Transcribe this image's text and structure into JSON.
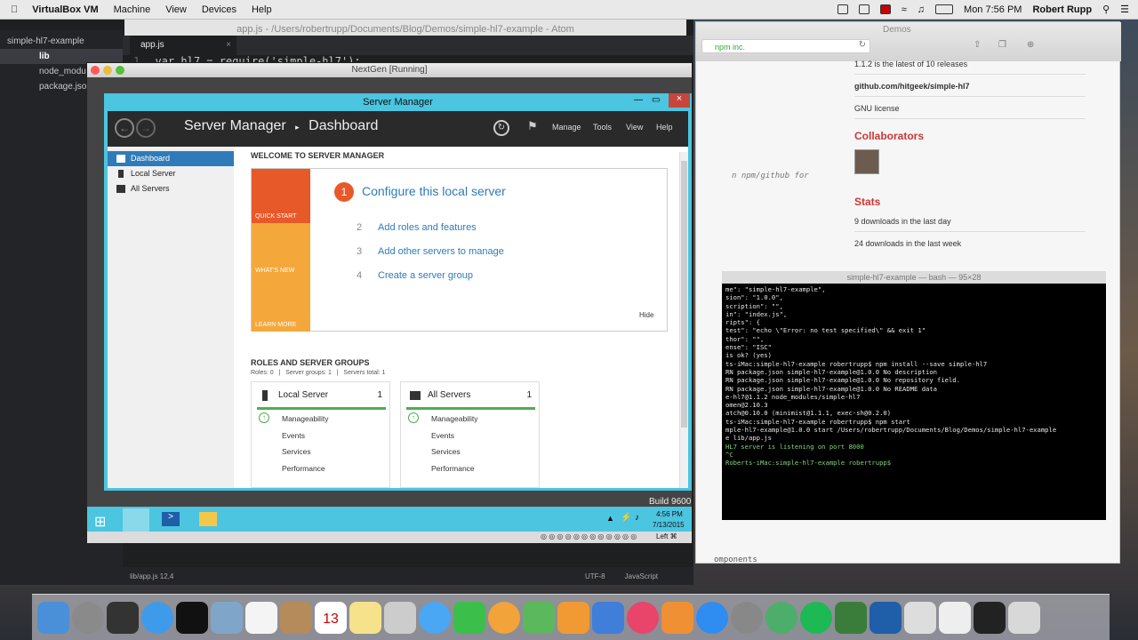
{
  "menubar": {
    "app_name": "VirtualBox VM",
    "items": [
      "Machine",
      "View",
      "Devices",
      "Help"
    ],
    "clock": "Mon 7:56 PM",
    "user": "Robert Rupp"
  },
  "atom": {
    "title": "app.js - /Users/robertrupp/Documents/Blog/Demos/simple-hl7-example - Atom",
    "tree": [
      "simple-hl7-example",
      "lib",
      "node_modules",
      "package.json"
    ],
    "tab": "app.js",
    "code_line_num": "1",
    "code_line": "var hl7 = require('simple-hl7');",
    "status_left": "lib/app.js  12,4",
    "status_enc": "UTF-8",
    "status_lang": "JavaScript"
  },
  "safari": {
    "title": "Demos",
    "address": "npm inc.",
    "releases": "1.1.2 is the latest of 10 releases",
    "repo": "github.com/hitgeek/simple-hl7",
    "license": "GNU license",
    "collaborators_heading": "Collaborators",
    "stats_heading": "Stats",
    "stat1": "9 downloads in the last day",
    "stat2": "24 downloads in the last week",
    "italic_hint": "n npm/github for",
    "components": "omponents"
  },
  "terminal": {
    "title": "simple-hl7-example — bash — 95×28",
    "lines": [
      "me\": \"simple-hl7-example\",",
      "sion\": \"1.0.0\",",
      "scription\": \"\",",
      "in\": \"index.js\",",
      "ripts\": {",
      "test\": \"echo \\\"Error: no test specified\\\" && exit 1\"",
      "",
      "thor\": \"\",",
      "ense\": \"ISC\"",
      "",
      "",
      "is ok? (yes)",
      "ts-iMac:simple-hl7-example robertrupp$ npm install --save simple-hl7",
      "RN package.json simple-hl7-example@1.0.0 No description",
      "RN package.json simple-hl7-example@1.0.0 No repository field.",
      "RN package.json simple-hl7-example@1.0.0 No README data",
      "e-hl7@1.1.2 node_modules/simple-hl7",
      "omen@2.10.3",
      "atch@0.10.0 (minimist@1.1.1, exec-sh@0.2.0)",
      "ts-iMac:simple-hl7-example robertrupp$ npm start",
      "",
      "mple-hl7-example@1.0.0 start /Users/robertrupp/Documents/Blog/Demos/simple-hl7-example",
      "e lib/app.js",
      "",
      "HL7 server is listening on port 8000",
      "^C",
      "Roberts-iMac:simple-hl7-example robertrupp$ "
    ]
  },
  "vbox": {
    "title": "NextGen [Running]",
    "build": "Build 9600",
    "host_key": "Left ⌘"
  },
  "server_manager": {
    "window_title": "Server Manager",
    "breadcrumb_app": "Server Manager",
    "breadcrumb_page": "Dashboard",
    "menu": [
      "Manage",
      "Tools",
      "View",
      "Help"
    ],
    "nav": [
      "Dashboard",
      "Local Server",
      "All Servers"
    ],
    "welcome": "WELCOME TO SERVER MANAGER",
    "tiles": [
      "QUICK START",
      "WHAT'S NEW",
      "LEARN MORE"
    ],
    "task1_num": "1",
    "task1": "Configure this local server",
    "tasks": [
      {
        "num": "2",
        "label": "Add roles and features"
      },
      {
        "num": "3",
        "label": "Add other servers to manage"
      },
      {
        "num": "4",
        "label": "Create a server group"
      }
    ],
    "hide": "Hide",
    "roles_heading": "ROLES AND SERVER GROUPS",
    "roles_summary": "Roles: 0   |   Server groups: 1   |   Servers total: 1",
    "cards": [
      {
        "title": "Local Server",
        "count": "1",
        "rows": [
          "Manageability",
          "Events",
          "Services",
          "Performance"
        ]
      },
      {
        "title": "All Servers",
        "count": "1",
        "rows": [
          "Manageability",
          "Events",
          "Services",
          "Performance"
        ]
      }
    ]
  },
  "guest_taskbar": {
    "time": "4:56 PM",
    "date": "7/13/2015"
  },
  "colors": {
    "accent_blue": "#2f7bb9",
    "quick_start": "#e8592a",
    "tile_orange": "#f4a83c",
    "npm_red": "#cb3837"
  }
}
